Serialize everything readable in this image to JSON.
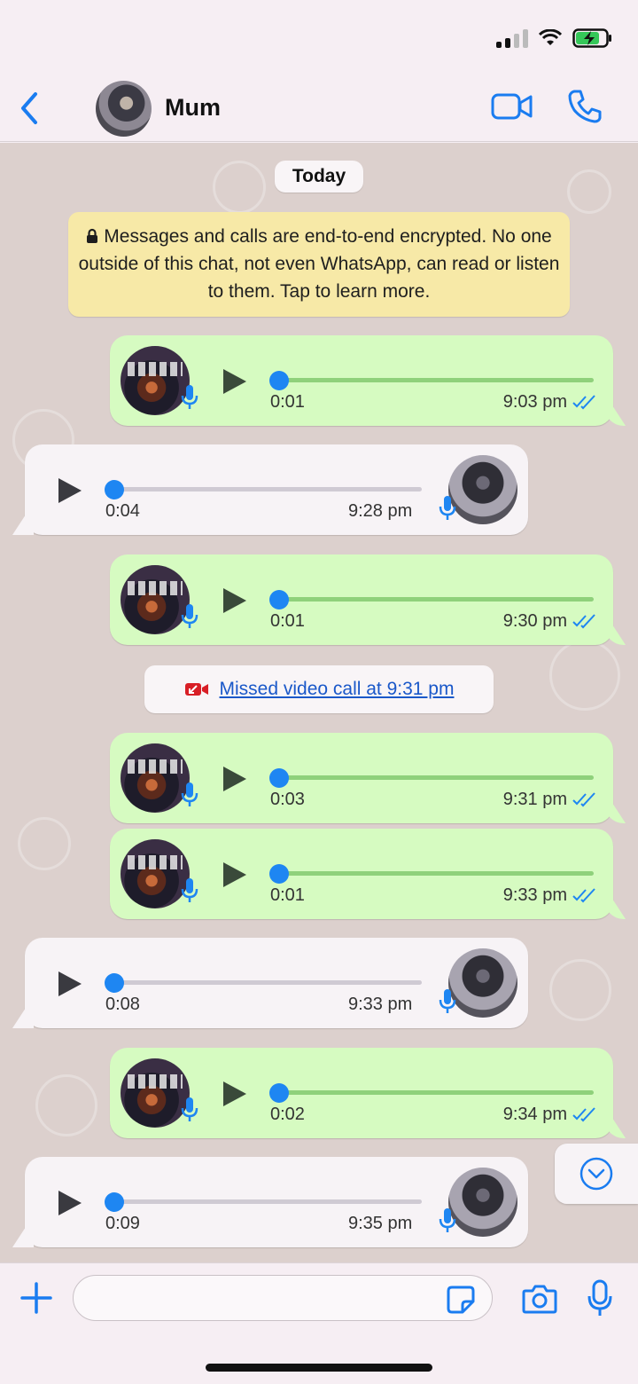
{
  "header": {
    "contact_name": "Mum"
  },
  "chat": {
    "date_label": "Today",
    "encryption_notice": "Messages and calls are end-to-end encrypted. No one outside of this chat, not even WhatsApp, can read or listen to them. Tap to learn more.",
    "missed_call": "Missed video call at 9:31 pm",
    "messages": [
      {
        "direction": "outgoing",
        "duration": "0:01",
        "time": "9:03 pm",
        "read": true
      },
      {
        "direction": "incoming",
        "duration": "0:04",
        "time": "9:28 pm"
      },
      {
        "direction": "outgoing",
        "duration": "0:01",
        "time": "9:30 pm",
        "read": true
      },
      {
        "direction": "outgoing",
        "duration": "0:03",
        "time": "9:31 pm",
        "read": true
      },
      {
        "direction": "outgoing",
        "duration": "0:01",
        "time": "9:33 pm",
        "read": true
      },
      {
        "direction": "incoming",
        "duration": "0:08",
        "time": "9:33 pm"
      },
      {
        "direction": "outgoing",
        "duration": "0:02",
        "time": "9:34 pm",
        "read": true
      },
      {
        "direction": "incoming",
        "duration": "0:09",
        "time": "9:35 pm"
      }
    ]
  },
  "input": {
    "value": "",
    "placeholder": ""
  },
  "colors": {
    "accent": "#1a7cf0",
    "outgoing_bubble": "#d6fbc1",
    "incoming_bubble": "#f7f3f6",
    "encryption_notice_bg": "#f7e9a7",
    "missed_call_icon": "#d81f26"
  }
}
